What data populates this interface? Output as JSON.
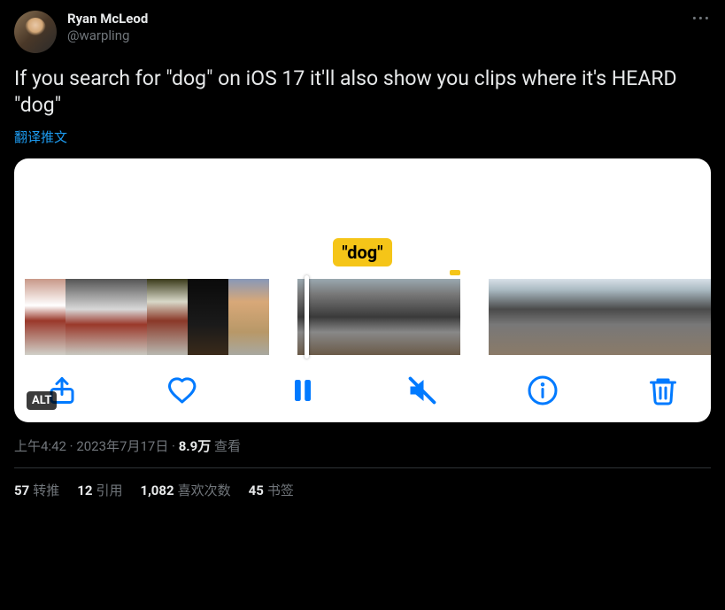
{
  "author": {
    "display_name": "Ryan McLeod",
    "handle": "@warpling"
  },
  "tweet_text": "If you search for \"dog\" on iOS 17 it'll also show you clips where it's HEARD \"dog\"",
  "translate_label": "翻译推文",
  "media": {
    "search_tag": "\"dog\"",
    "alt_badge": "ALT"
  },
  "meta": {
    "time": "上午4:42",
    "date": "2023年7月17日",
    "views_count": "8.9万",
    "views_label": "查看",
    "separator": " · "
  },
  "stats": {
    "retweets_count": "57",
    "retweets_label": "转推",
    "quotes_count": "12",
    "quotes_label": "引用",
    "likes_count": "1,082",
    "likes_label": "喜欢次数",
    "bookmarks_count": "45",
    "bookmarks_label": "书签"
  }
}
